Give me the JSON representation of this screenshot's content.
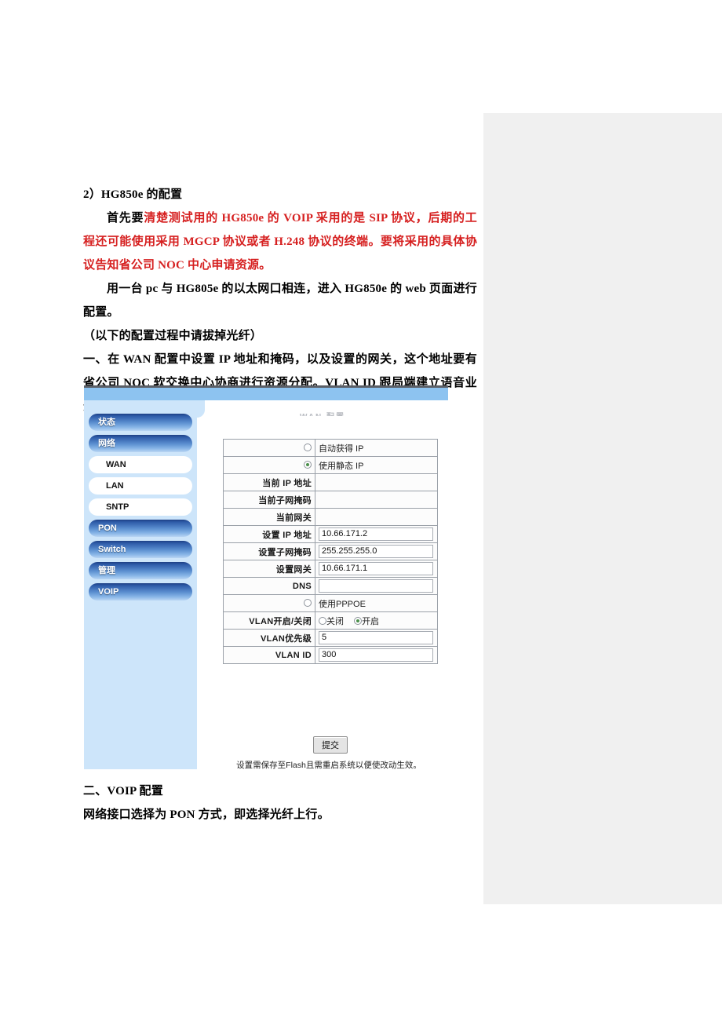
{
  "document": {
    "heading": "2）HG850e 的配置",
    "paragraphs": [
      {
        "id": "p1",
        "prefix": "首先要",
        "highlight": "清楚测试用的 HG850e 的 VOIP 采用的是 SIP 协议，后期的工程还可能使用采用 MGCP 协议或者 H.248 协议的终端。要将采用的具体协议告知省公司 NOC 中心申请资源。"
      },
      {
        "id": "p2",
        "text": "用一台 pc 与 HG805e 的以太网口相连，进入 HG850e 的 web 页面进行配置。"
      },
      {
        "id": "p3",
        "text": "（以下的配置过程中请拔掉光纤）"
      },
      {
        "id": "p4",
        "text": "一、在 WAN 配置中设置 IP 地址和掩码，以及设置的网关，这个地址要有省公司 NOC 软交换中心协商进行资源分配。VLAN ID 跟局端建立语音业务流的网络侧 VLAN 一致。最后点击提交即可。"
      }
    ],
    "closing": [
      {
        "id": "c1",
        "text": "二、VOIP 配置"
      },
      {
        "id": "c2",
        "text": "网络接口选择为 PON 方式，即选择光纤上行。"
      }
    ]
  },
  "screenshot": {
    "pane_title": "WAN 配置",
    "sidebar": [
      {
        "label": "状态",
        "type": "main"
      },
      {
        "label": "网络",
        "type": "main"
      },
      {
        "label": "WAN",
        "type": "sub"
      },
      {
        "label": "LAN",
        "type": "sub"
      },
      {
        "label": "SNTP",
        "type": "sub"
      },
      {
        "label": "PON",
        "type": "main"
      },
      {
        "label": "Switch",
        "type": "main"
      },
      {
        "label": "管理",
        "type": "main"
      },
      {
        "label": "VOIP",
        "type": "main"
      }
    ],
    "form": {
      "mode_auto": {
        "label": "自动获得 IP",
        "selected": false
      },
      "mode_static": {
        "label": "使用静态 IP",
        "selected": true
      },
      "mode_pppoe": {
        "label": "使用PPPOE",
        "selected": false
      },
      "rows": [
        {
          "label": "当前 IP 地址",
          "value": "",
          "kind": "readonly"
        },
        {
          "label": "当前子网掩码",
          "value": "",
          "kind": "readonly"
        },
        {
          "label": "当前网关",
          "value": "",
          "kind": "readonly"
        },
        {
          "label": "设置 IP 地址",
          "value": "10.66.171.2",
          "kind": "input"
        },
        {
          "label": "设置子网掩码",
          "value": "255.255.255.0",
          "kind": "input"
        },
        {
          "label": "设置网关",
          "value": "10.66.171.1",
          "kind": "input"
        },
        {
          "label": "DNS",
          "value": "",
          "kind": "input"
        }
      ],
      "vlan_switch": {
        "label": "VLAN开启/关闭",
        "off_label": "关闭",
        "on_label": "开启",
        "selected": "on"
      },
      "vlan_priority": {
        "label": "VLAN优先级",
        "value": "5"
      },
      "vlan_id": {
        "label": "VLAN ID",
        "value": "300"
      }
    },
    "submit_label": "提交",
    "footer_note": "设置需保存至Flash且需重启系统以便使改动生效。"
  },
  "colors": {
    "accent_red": "#d62020",
    "nav_blue_dark": "#1d3f85",
    "nav_panel": "#cde5fa",
    "header_band": "#8dc3f0",
    "side_panel_grey": "#f0f0f0"
  }
}
